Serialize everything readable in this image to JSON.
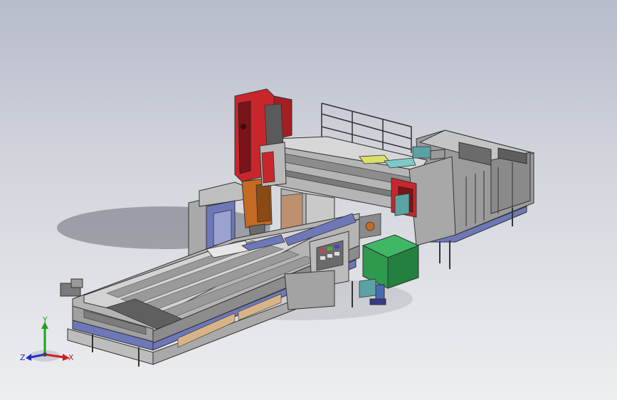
{
  "viewport": {
    "background_top": "#b7bccb",
    "background_bottom": "#eceef1"
  },
  "model": {
    "machine_plate_text": "",
    "colors": {
      "head_red": "#c9262b",
      "head_dark": "#7a1418",
      "housing_orange": "#c46a22",
      "control_cabinet_green": "#2e9a4e",
      "bed_blue": "#6e78b8",
      "body_grey": "#a9a9a9",
      "body_light": "#cfcfcf",
      "guard_panels": "#8e8e8e"
    }
  },
  "triad": {
    "x_label": "X",
    "y_label": "Y",
    "z_label": "Z",
    "x_color": "#cc2020",
    "y_color": "#20a020",
    "z_color": "#2030c0"
  }
}
